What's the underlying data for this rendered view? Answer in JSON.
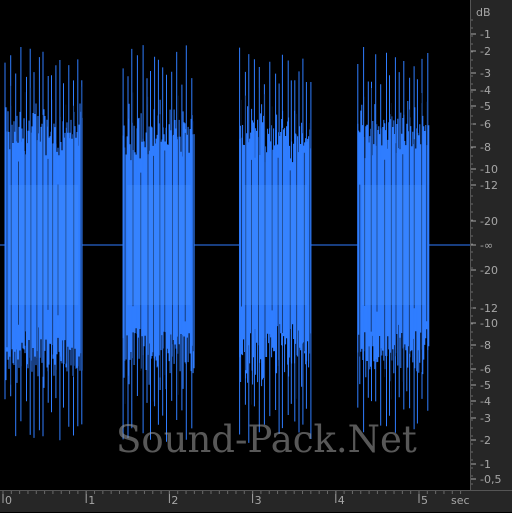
{
  "colors": {
    "waveform": "#2f7dff",
    "waveform_bright": "#4a96ff",
    "background": "#000000",
    "ruler_bg": "#262626",
    "ruler_text": "#a6a6a6"
  },
  "watermark": "Sound-Pack.Net",
  "db_ruler": {
    "unit": "dB",
    "top_labels": [
      "-1",
      "-2",
      "-3",
      "-4",
      "-5",
      "-6",
      "-8",
      "-10",
      "-12",
      "-20"
    ],
    "center_label": "-∞",
    "bottom_labels": [
      "-20",
      "-12",
      "-10",
      "-8",
      "-6",
      "-5",
      "-4",
      "-3",
      "-2",
      "-1",
      "-0,5"
    ]
  },
  "time_ruler": {
    "unit": "sec",
    "labels": [
      "0",
      "1",
      "2",
      "3",
      "4",
      "5"
    ]
  },
  "bursts": [
    {
      "start": 0.0,
      "end": 0.93
    },
    {
      "start": 1.42,
      "end": 2.28
    },
    {
      "start": 2.82,
      "end": 3.68
    },
    {
      "start": 4.24,
      "end": 5.1
    }
  ]
}
